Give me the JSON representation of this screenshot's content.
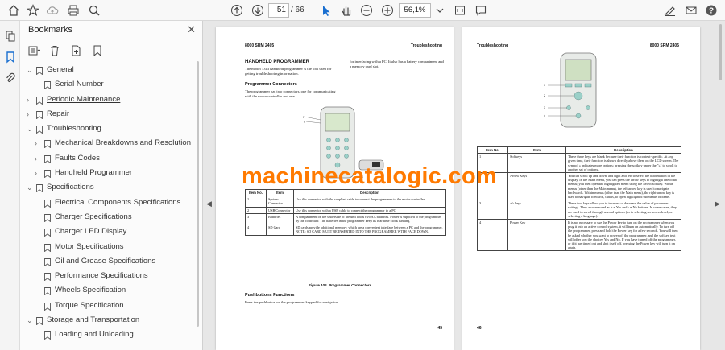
{
  "toolbar": {
    "current_page": "51",
    "total_pages": "/ 66",
    "zoom": "56,1%"
  },
  "bookmarks": {
    "title": "Bookmarks",
    "items": [
      {
        "label": "General",
        "level": 0,
        "expanded": true
      },
      {
        "label": "Serial Number",
        "level": 1
      },
      {
        "label": "Periodic Maintenance",
        "level": 0,
        "expanded": false,
        "underline": true
      },
      {
        "label": "Repair",
        "level": 0,
        "expanded": false
      },
      {
        "label": "Troubleshooting",
        "level": 0,
        "expanded": true
      },
      {
        "label": "Mechanical Breakdowns and Resolution",
        "level": 1,
        "expanded": false
      },
      {
        "label": "Faults Codes",
        "level": 1,
        "expanded": false
      },
      {
        "label": "Handheld Programmer",
        "level": 1,
        "expanded": false
      },
      {
        "label": "Specifications",
        "level": 0,
        "expanded": true
      },
      {
        "label": "Electrical Components Specifications",
        "level": 1
      },
      {
        "label": "Charger Specifications",
        "level": 1
      },
      {
        "label": "Charger LED Display",
        "level": 1
      },
      {
        "label": "Motor Specifications",
        "level": 1
      },
      {
        "label": "Oil and Grease Specifications",
        "level": 1
      },
      {
        "label": "Performance Specifications",
        "level": 1
      },
      {
        "label": "Wheels Specification",
        "level": 1
      },
      {
        "label": "Torque Specification",
        "level": 1
      },
      {
        "label": "Storage and Transportation",
        "level": 0,
        "expanded": true
      },
      {
        "label": "Loading and Unloading",
        "level": 1
      }
    ]
  },
  "left_page": {
    "header_left": "8000 SRM 2405",
    "header_right": "Troubleshooting",
    "title": "HANDHELD PROGRAMMER",
    "intro": "The model 1313 handheld programmer is the tool used for getting troubleshooting information.",
    "col2_intro": "for interfacing with a PC. It also has a battery compartment and a memory card slot.",
    "subtitle": "Programmer Connectors",
    "connectors_text": "The programmer has two connectors, one for communicating with the motor controller and one",
    "table_headers": [
      "Item No.",
      "Item",
      "Description"
    ],
    "table_rows": [
      [
        "1",
        "System Connector",
        "Use this connector with the supplied cable to connect the programmer to the motor controller"
      ],
      [
        "2",
        "USB Connector",
        "Use this connector with a USB cable to connect the programmer to a PC"
      ],
      [
        "3",
        "Batteries",
        "A compartment on the underside of the unit holds two AA batteries. Power is supplied to the programmer by the controller. The batteries in the programmer keep its real-time clock running."
      ],
      [
        "4",
        "SD Card",
        "SD cards provide additional memory, which are a convenient interface between a PC and the programmer. NOTE: SD CARD MUST BE INSERTED INTO THE PROGRAMMER WITH FACE DOWN."
      ]
    ],
    "figure_caption": "Figure 106. Programmer Connectors",
    "pb_title": "Pushbuttons Functions",
    "pb_text": "Press the pushbutton on the programmer keypad for navigation.",
    "page_number": "45"
  },
  "right_page": {
    "header_left": "Troubleshooting",
    "header_right": "8000 SRM 2405",
    "table_headers": [
      "Item No.",
      "Item",
      "Description"
    ],
    "table_rows": [
      [
        "1",
        "Softkeys",
        "These three keys are blank because their function is context-specific. At any given time, their function is shown directly above them on the LCD screen. The symbol » indicates more options; pressing the softkey under the \"»\" to scroll to another set of options."
      ],
      [
        "2",
        "Arrow Keys",
        "You can scroll up and down, and right and left to select the information in the display. In the Main menu, you can press the arrow keys to highlight one of the menus; you then open the highlighted menu using the Select softkey. Within menus (other than the Main menu), the left-arrow key is used to navigate backwards. Within menus (other than the Main menu), the right-arrow key is used to navigate forwards, that is, to open highlighted submenus or items."
      ],
      [
        "3",
        "+/- keys",
        "These two keys allow you to increase or decrease the value of parameter settings. They also are used as + = Yes and - = No buttons. In some cases, they are used to scroll through several options (as in selecting an access level, or selecting a language)."
      ],
      [
        "4",
        "Power Key",
        "It is not necessary to use the Power key to turn on the programmer when you plug it into an active control system, it will turn on automatically. To turn off the programmer, press and hold the Power key for a few seconds. You will then be asked whether you want to power off the programmer, and the softkey text will offer you the choices Yes and No. If you have turned off the programmer, or if it has timed out and shut itself off, pressing the Power key will turn it on again."
      ]
    ],
    "page_number": "46"
  },
  "watermark": "machinecatalogic.com",
  "colors": {
    "watermark": "#ff7a00",
    "accent": "#1a6fd0"
  }
}
